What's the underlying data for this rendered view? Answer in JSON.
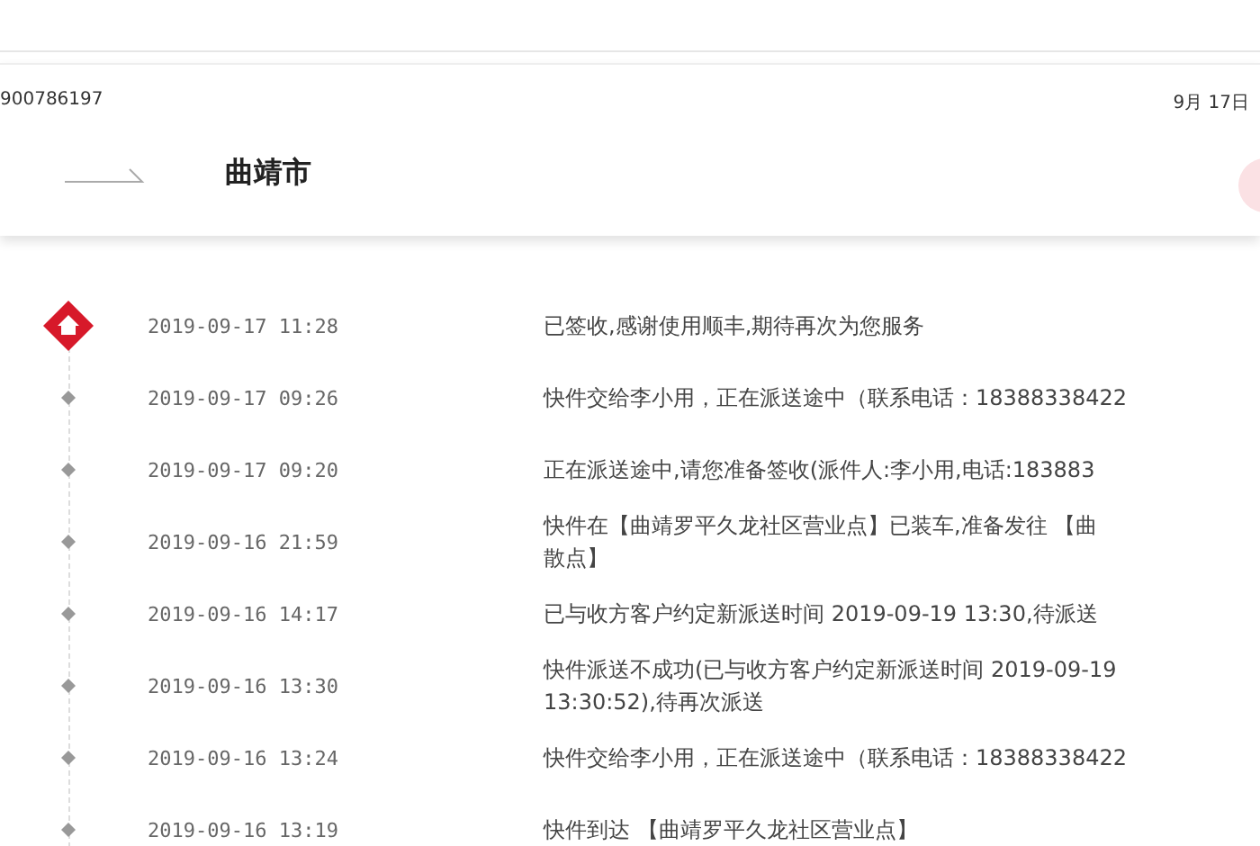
{
  "header": {
    "tracking_number": "900786197",
    "date": "9月 17日",
    "city": "曲靖市"
  },
  "events": [
    {
      "kind": "delivered",
      "time": "2019-09-17 11:28",
      "lines": [
        "已签收,感谢使用顺丰,期待再次为您服务"
      ]
    },
    {
      "kind": "transit",
      "time": "2019-09-17 09:26",
      "lines": [
        "快件交给李小用，正在派送途中（联系电话：18388338422"
      ]
    },
    {
      "kind": "transit",
      "time": "2019-09-17 09:20",
      "lines": [
        "正在派送途中,请您准备签收(派件人:李小用,电话:183883"
      ]
    },
    {
      "kind": "transit",
      "time": "2019-09-16 21:59",
      "lines": [
        "快件在【曲靖罗平久龙社区营业点】已装车,准备发往 【曲",
        "散点】"
      ]
    },
    {
      "kind": "transit",
      "time": "2019-09-16 14:17",
      "lines": [
        "已与收方客户约定新派送时间 2019-09-19 13:30,待派送"
      ]
    },
    {
      "kind": "transit",
      "time": "2019-09-16 13:30",
      "lines": [
        "快件派送不成功(已与收方客户约定新派送时间 2019-09-19",
        "13:30:52),待再次派送"
      ]
    },
    {
      "kind": "transit",
      "time": "2019-09-16 13:24",
      "lines": [
        "快件交给李小用，正在派送途中（联系电话：18388338422"
      ]
    },
    {
      "kind": "transit",
      "time": "2019-09-16 13:19",
      "lines": [
        "快件到达 【曲靖罗平久龙社区营业点】"
      ]
    }
  ]
}
